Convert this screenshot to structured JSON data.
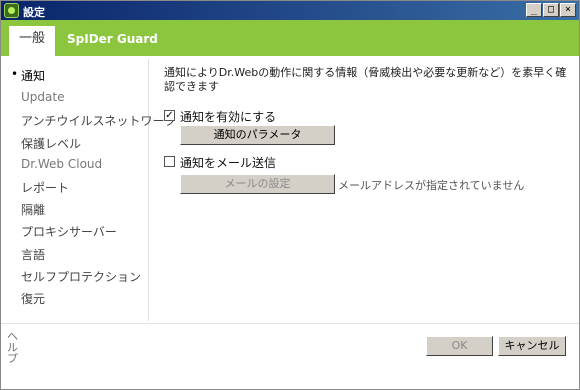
{
  "window": {
    "title": "設定"
  },
  "titlebar": {
    "minimize_glyph": "_",
    "maximize_glyph": "□",
    "close_glyph": "×"
  },
  "tabs": [
    {
      "label": "一般",
      "active": true
    },
    {
      "label": "SpIDer Guard",
      "active": false
    }
  ],
  "sidebar": {
    "bullet": "•",
    "items": [
      {
        "label": "通知",
        "active": true
      },
      {
        "label": "Update"
      },
      {
        "label": "アンチウイルスネットワーク"
      },
      {
        "label": "保護レベル"
      },
      {
        "label": "Dr.Web Cloud"
      },
      {
        "label": "レポート"
      },
      {
        "label": "隔離"
      },
      {
        "label": "プロキシサーバー"
      },
      {
        "label": "言語"
      },
      {
        "label": "セルフプロテクション"
      },
      {
        "label": "復元"
      }
    ]
  },
  "main": {
    "description": "通知によりDr.Webの動作に関する情報（脅威検出や必要な更新など）を素早く確認できます",
    "enable_notifications": {
      "label": "通知を有効にする",
      "checked": true,
      "check_glyph": "✓"
    },
    "notification_params_button": "通知のパラメータ",
    "email_notifications": {
      "label": "通知をメール送信",
      "checked": false
    },
    "mail_settings_button": "メールの設定",
    "email_note": "メールアドレスが指定されていません"
  },
  "footer": {
    "help": "ヘルプ",
    "ok": "OK",
    "cancel": "キャンセル"
  },
  "colors": {
    "accent": "#8cc63f",
    "titlebar": "#0a246a"
  }
}
